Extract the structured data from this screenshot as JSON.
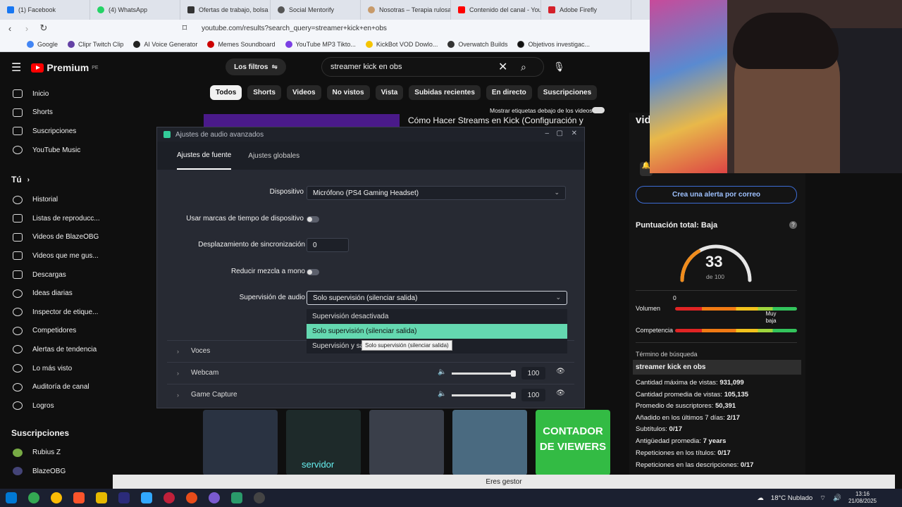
{
  "browser": {
    "tabs": [
      {
        "label": "(1) Facebook",
        "color": "#1877f2"
      },
      {
        "label": "(4) WhatsApp",
        "color": "#25d366"
      },
      {
        "label": "Ofertas de trabajo, bolsa d",
        "color": "#333333"
      },
      {
        "label": "Social Mentorify",
        "color": "#555555"
      },
      {
        "label": "Nosotras – Terapia rulosa",
        "color": "#c79a6a"
      },
      {
        "label": "Contenido del canal - You",
        "color": "#ff0000"
      },
      {
        "label": "Adobe Firefly",
        "color": "#d4202a"
      }
    ],
    "url": "youtube.com/results?search_query=streamer+kick+en+obs",
    "bookmarks": [
      {
        "label": "Google",
        "color": "#4285f4"
      },
      {
        "label": "Clipr Twitch Clip",
        "color": "#6441a5"
      },
      {
        "label": "AI Voice Generator",
        "color": "#222222"
      },
      {
        "label": "Memes Soundboard",
        "color": "#cc0000"
      },
      {
        "label": "YouTube MP3 Tikto...",
        "color": "#7b3fe4"
      },
      {
        "label": "KickBot VOD Dowlo...",
        "color": "#f5c400"
      },
      {
        "label": "Overwatch Builds",
        "color": "#333333"
      },
      {
        "label": "Objetivos investigac...",
        "color": "#111111"
      }
    ]
  },
  "youtube": {
    "brand": "Premium",
    "region": "PE",
    "filters_label": "Los filtros",
    "search_value": "streamer kick en obs",
    "chips": [
      "Todos",
      "Shorts",
      "Videos",
      "No vistos",
      "Vista",
      "Subidas recientes",
      "En directo",
      "Suscripciones"
    ],
    "show_labels": "Mostrar etiquetas debajo de los videos",
    "video_title": "Cómo Hacer Streams en Kick (Configuración y",
    "sidebar": [
      {
        "label": "Inicio"
      },
      {
        "label": "Shorts"
      },
      {
        "label": "Suscripciones"
      },
      {
        "label": "YouTube Music"
      }
    ],
    "you_section": "Tú",
    "you_items": [
      {
        "label": "Historial"
      },
      {
        "label": "Listas de reproducc..."
      },
      {
        "label": "Videos de BlazeOBG"
      },
      {
        "label": "Videos que me gus..."
      },
      {
        "label": "Descargas"
      },
      {
        "label": "Ideas diarias"
      },
      {
        "label": "Inspector de etique..."
      },
      {
        "label": "Competidores"
      },
      {
        "label": "Alertas de tendencia"
      },
      {
        "label": "Lo más visto"
      },
      {
        "label": "Auditoría de canal"
      },
      {
        "label": "Logros"
      }
    ],
    "subs_section": "Suscripciones",
    "subs": [
      {
        "label": "Rubius Z"
      },
      {
        "label": "BlazeOBG"
      }
    ],
    "thumb_texts": [
      "servidor",
      "CONTADOR DE VIEWERS"
    ]
  },
  "dialog": {
    "title": "Ajustes de audio avanzados",
    "tabs": [
      "Ajustes de fuente",
      "Ajustes globales"
    ],
    "device_label": "Dispositivo",
    "device_value": "Micrófono (PS4 Gaming Headset)",
    "timestamps_label": "Usar marcas de tiempo de dispositivo",
    "sync_label": "Desplazamiento de sincronización",
    "sync_value": "0",
    "mono_label": "Reducir mezcla a mono",
    "monitor_label": "Supervisión de audio",
    "monitor_value": "Solo supervisión (silenciar salida)",
    "options": [
      "Supervisión desactivada",
      "Solo supervisión (silenciar salida)",
      "Supervisión y sa"
    ],
    "tooltip": "Solo supervisión (silenciar salida)",
    "sources": [
      {
        "name": "Voces",
        "volume": ""
      },
      {
        "name": "Webcam",
        "volume": "100"
      },
      {
        "name": "Game Capture",
        "volume": "100"
      }
    ]
  },
  "vidiq": {
    "brand": "vid",
    "alert_button": "Crea una alerta por correo",
    "score_label": "Puntuación total: Baja",
    "score_value": "33",
    "score_max": "de 100",
    "score_fraction": 0.33,
    "gauge_zero": "0",
    "volume_label": "Volumen",
    "competition_label": "Competencia",
    "competition_marker": "Muy baja",
    "term_label": "Término de búsqueda",
    "term_value": "streamer kick en obs",
    "stats": [
      {
        "label": "Cantidad máxima de vistas:",
        "value": "931,099"
      },
      {
        "label": "Cantidad promedia de vistas:",
        "value": "105,135"
      },
      {
        "label": "Promedio de suscriptores:",
        "value": "50,391"
      },
      {
        "label": "Añadido en los últimos 7 días:",
        "value": "2/17"
      },
      {
        "label": "Subtítulos:",
        "value": "0/17"
      },
      {
        "label": "Antigüedad promedia:",
        "value": "7 years"
      },
      {
        "label": "Repeticiones en los títulos:",
        "value": "0/17"
      },
      {
        "label": "Repeticiones en las descripciones:",
        "value": "0/17"
      }
    ]
  },
  "statusbar": "Eres gestor",
  "taskbar": {
    "weather": "18°C  Nublado",
    "time": "13:16",
    "date": "21/08/2025",
    "icons": [
      "#0078d4",
      "#34a853",
      "#fb542b",
      "#e6b800",
      "#2b2b7a",
      "#31a8ff",
      "#c0203a",
      "#e84c1a",
      "#7a5ad0",
      "#2a9a6a",
      "#444"
    ]
  }
}
